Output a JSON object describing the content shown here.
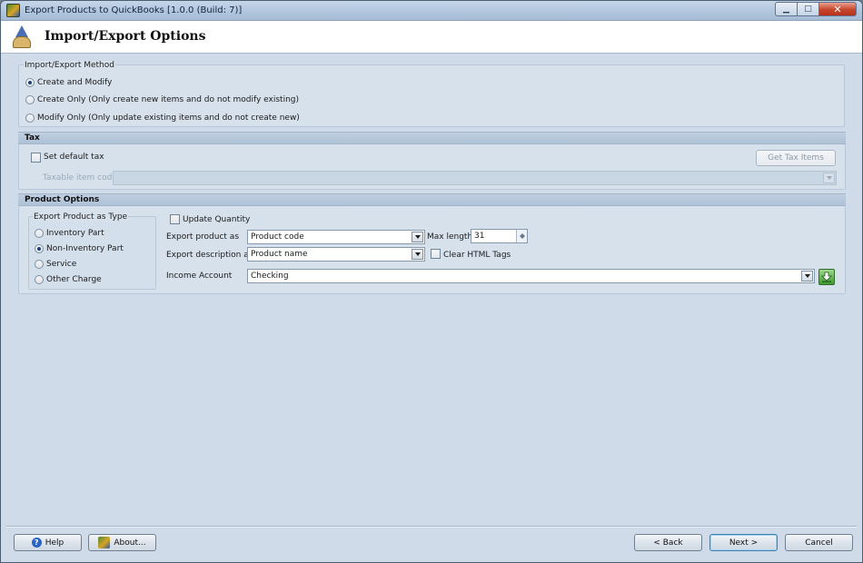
{
  "window": {
    "title": "Export Products to QuickBooks [1.0.0 (Build: 7)]",
    "minimize_glyph": "▁",
    "maximize_glyph": "□",
    "close_glyph": "✕"
  },
  "header": {
    "title": "Import/Export Options",
    "icon": "wizard-icon"
  },
  "method": {
    "legend": "Import/Export Method",
    "options": [
      {
        "label": "Create and Modify",
        "selected": true
      },
      {
        "label": "Create Only (Only create new items and do not modify existing)",
        "selected": false
      },
      {
        "label": "Modify Only (Only update existing items and do not create new)",
        "selected": false
      }
    ]
  },
  "tax": {
    "section_title": "Tax",
    "default_tax_label": "Set default tax",
    "default_tax_checked": false,
    "get_tax_items_label": "Get Tax Items",
    "taxable_code_label": "Taxable item code",
    "taxable_code_value": ""
  },
  "product": {
    "section_title": "Product Options",
    "type_legend": "Export Product as Type",
    "types": [
      {
        "label": "Inventory Part",
        "selected": false
      },
      {
        "label": "Non-Inventory Part",
        "selected": true
      },
      {
        "label": "Service",
        "selected": false
      },
      {
        "label": "Other Charge",
        "selected": false
      }
    ],
    "update_quantity_label": "Update Quantity",
    "update_quantity_checked": false,
    "export_product_as_label": "Export product as",
    "export_product_as_value": "Product code",
    "max_length_label": "Max length",
    "max_length_value": "31",
    "export_description_label": "Export description as",
    "export_description_value": "Product name",
    "clear_html_label": "Clear HTML Tags",
    "clear_html_checked": false,
    "income_account_label": "Income Account",
    "income_account_value": "Checking"
  },
  "footer": {
    "help_label": "Help",
    "about_label": "About...",
    "back_label": "< Back",
    "next_label": "Next >",
    "cancel_label": "Cancel"
  },
  "colors": {
    "window_bg": "#cfdbe8",
    "section_bar": "#aec1d6",
    "accent_green": "#3f9a2f"
  }
}
